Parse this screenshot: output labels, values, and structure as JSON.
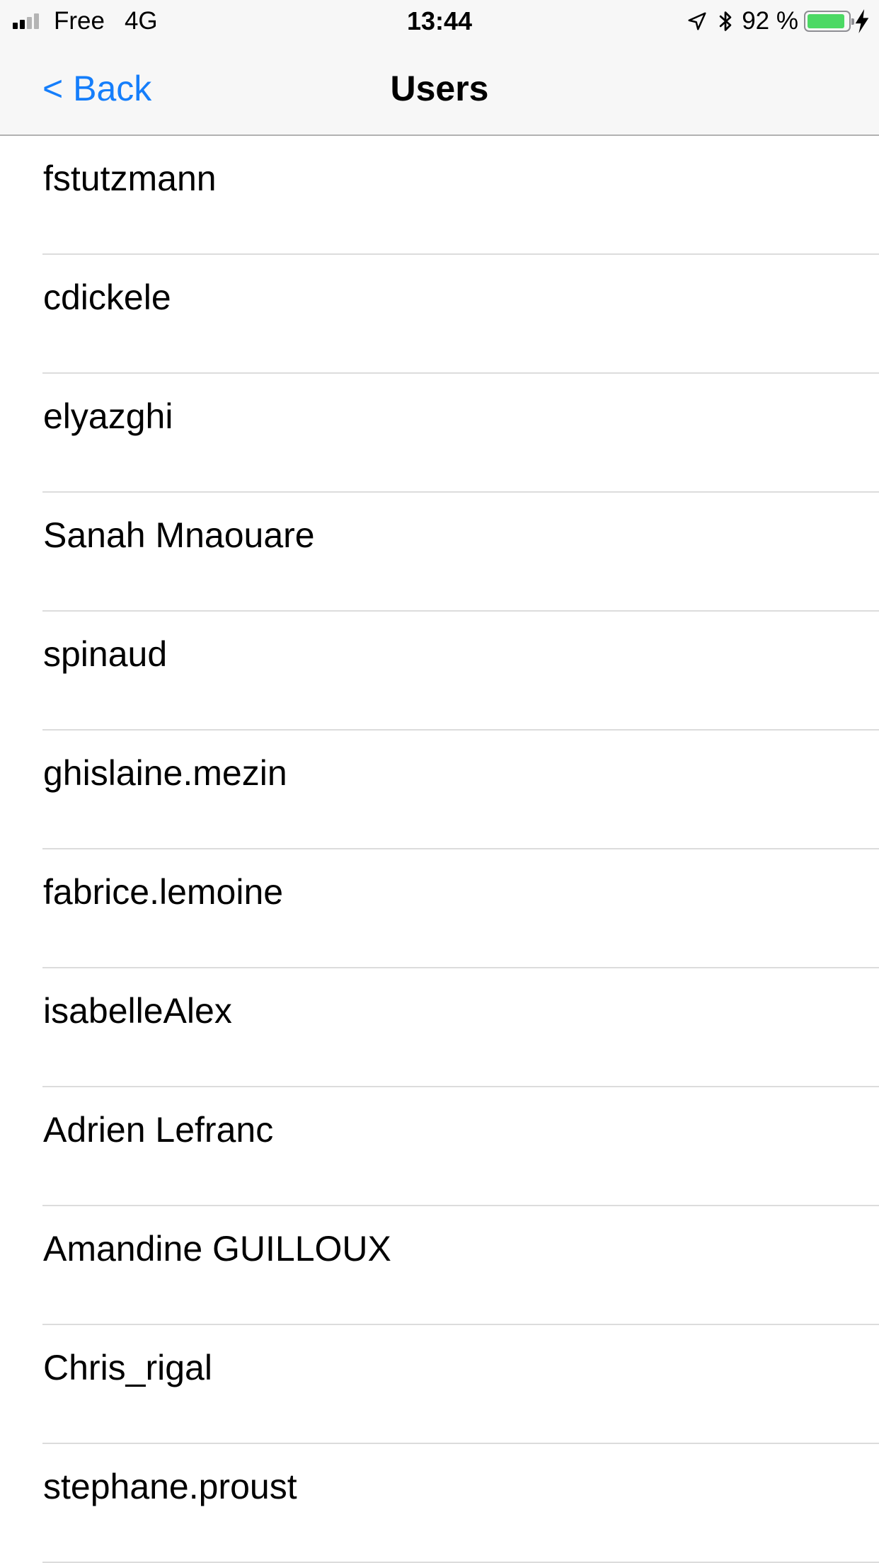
{
  "status_bar": {
    "carrier": "Free",
    "network": "4G",
    "time": "13:44",
    "battery_text": "92 %",
    "battery_level": 0.92,
    "signal_bars_filled": 2,
    "signal_bars_total": 4,
    "icons": [
      "signal-bars-icon",
      "location-arrow-icon",
      "bluetooth-icon",
      "battery-icon",
      "charging-bolt-icon"
    ],
    "colors": {
      "battery": "#4cd964",
      "signal_on": "#000000",
      "signal_off": "#b4b4b4"
    }
  },
  "nav": {
    "back_label": "< Back",
    "title": "Users",
    "accent_color": "#157efb"
  },
  "users": [
    "fstutzmann",
    "cdickele",
    "elyazghi",
    "Sanah Mnaouare",
    "spinaud",
    "ghislaine.mezin",
    "fabrice.lemoine",
    "isabelleAlex",
    "Adrien Lefranc",
    "Amandine GUILLOUX",
    "Chris_rigal",
    "stephane.proust"
  ]
}
